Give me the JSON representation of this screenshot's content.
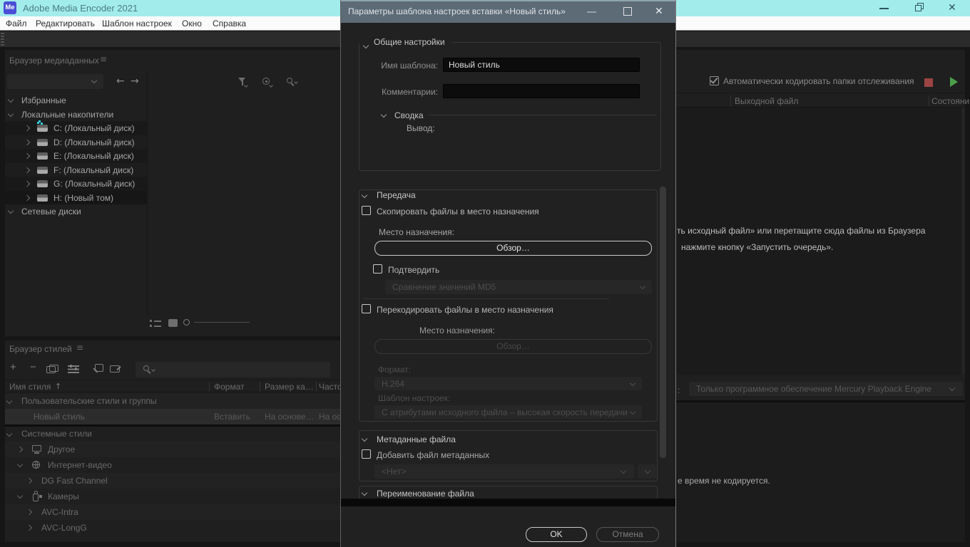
{
  "window": {
    "title": "Adobe Media Encoder 2021",
    "logo": "Me"
  },
  "menu": {
    "items": [
      "Файл",
      "Редактировать",
      "Шаблон настроек",
      "Окно",
      "Справка"
    ]
  },
  "media_browser": {
    "title": "Браузер медиаданных",
    "tree": [
      {
        "label": "Избранные"
      },
      {
        "label": "Локальные накопители"
      },
      {
        "label": "C: (Локальный диск)"
      },
      {
        "label": "D: (Локальный диск)"
      },
      {
        "label": "E: (Локальный диск)"
      },
      {
        "label": "F: (Локальный диск)"
      },
      {
        "label": "G: (Локальный диск)"
      },
      {
        "label": "H: (Новый том)"
      },
      {
        "label": "Сетевые диски"
      }
    ]
  },
  "preset_browser": {
    "title": "Браузер стилей",
    "columns": [
      "Имя стиля",
      "Формат",
      "Размер ка…",
      "Часто…"
    ],
    "rows": [
      {
        "name": "Пользовательские стили и группы"
      },
      {
        "name": "Новый стиль",
        "format": "Вставить",
        "frame_size": "На основе…",
        "frame_rate": "На ос…"
      },
      {
        "name": "Системные стили"
      },
      {
        "name": "Другое"
      },
      {
        "name": "Интернет-видео"
      },
      {
        "name": "DG Fast Channel"
      },
      {
        "name": "Камеры"
      },
      {
        "name": "AVC-Intra"
      },
      {
        "name": "AVC-LongG"
      }
    ]
  },
  "queue": {
    "auto_encode_label": "Автоматически кодировать папки отслеживания",
    "columns": [
      "Выходной файл",
      "Состояни"
    ],
    "hint_line1": "ть исходный файл» или перетащите сюда файлы из Браузера",
    "hint_line2": "нажмите кнопку «Запустить очередь».",
    "renderer_label": ":",
    "renderer_value": "Только программное обеспечение Mercury Playback Engine",
    "watch_text": "е время не кодируется."
  },
  "dialog": {
    "title": "Параметры шаблона настроек вставки «Новый стиль»",
    "general": {
      "label": "Общие настройки",
      "name_label": "Имя шаблона:",
      "name_value": "Новый стиль",
      "comments_label": "Комментарии:",
      "comments_value": "",
      "summary_label": "Сводка",
      "output_label": "Вывод:"
    },
    "transfer": {
      "label": "Передача",
      "copy_checkbox": "Скопировать файлы в место назначения",
      "destination_label": "Место назначения:",
      "browse_button": "Обзор…",
      "verify_checkbox": "Подтвердить",
      "verify_value": "Сравнение значений MD5",
      "transcode_checkbox": "Перекодировать файлы в место назначения",
      "destination2_label": "Место назначения:",
      "browse2_button": "Обзор…",
      "format_label": "Формат:",
      "format_value": "H.264",
      "preset_label": "Шаблон настроек:",
      "preset_value": "С атрибутами исходного файла – высокая скорость передачи"
    },
    "metadata": {
      "label": "Метаданные файла",
      "add_checkbox": "Добавить файл метаданных",
      "value": "<Нет>"
    },
    "rename": {
      "label": "Переименование файла"
    },
    "ok_button": "OK",
    "cancel_button": "Отмена"
  },
  "colors": {
    "main_titlebar": "#a3ecec",
    "menubar": "#fbfbfb",
    "dialog_titlebar": "#5d6b77",
    "panel_bg": "#1f1f1f",
    "play_green": "#4aa04a",
    "stop_red": "#9c4343",
    "logo_blue": "#4a4fd6"
  }
}
